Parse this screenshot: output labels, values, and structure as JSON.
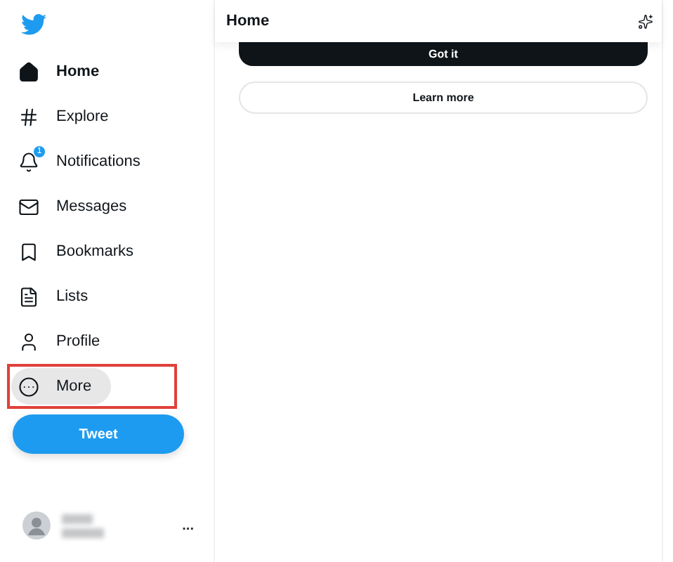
{
  "sidebar": {
    "items": [
      {
        "kind": "home",
        "label": "Home",
        "selected": true,
        "hovered": false,
        "annotated": false
      },
      {
        "kind": "explore",
        "label": "Explore",
        "selected": false,
        "hovered": false,
        "annotated": false
      },
      {
        "kind": "notifications",
        "label": "Notifications",
        "selected": false,
        "hovered": false,
        "annotated": false,
        "badge": "1"
      },
      {
        "kind": "messages",
        "label": "Messages",
        "selected": false,
        "hovered": false,
        "annotated": false
      },
      {
        "kind": "bookmarks",
        "label": "Bookmarks",
        "selected": false,
        "hovered": false,
        "annotated": false
      },
      {
        "kind": "lists",
        "label": "Lists",
        "selected": false,
        "hovered": false,
        "annotated": false
      },
      {
        "kind": "profile",
        "label": "Profile",
        "selected": false,
        "hovered": false,
        "annotated": false
      },
      {
        "kind": "more",
        "label": "More",
        "selected": false,
        "hovered": true,
        "annotated": true
      }
    ],
    "tweet_button": "Tweet",
    "account": {
      "more": "..."
    }
  },
  "main": {
    "title": "Home",
    "buttons": [
      {
        "kind": "primary",
        "label": "Got it"
      },
      {
        "kind": "secondary",
        "label": "Learn more"
      }
    ]
  }
}
